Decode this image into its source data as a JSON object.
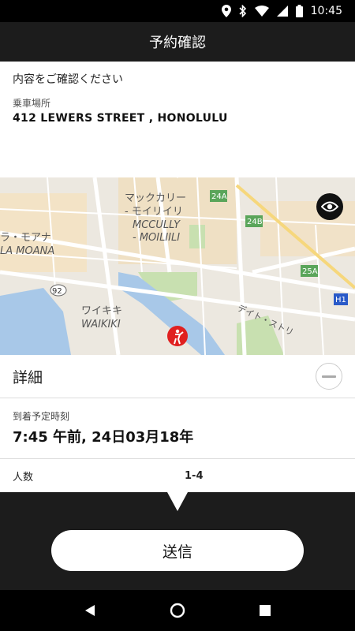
{
  "status_bar": {
    "time": "10:45"
  },
  "app_bar": {
    "title": "予約確認"
  },
  "confirm": {
    "prompt": "内容をご確認ください",
    "pickup_label": "乗車場所",
    "pickup_address": "412 LEWERS STREET , HONOLULU"
  },
  "map": {
    "labels": {
      "mccully_jp": "マックカリー",
      "moiliili_jp": "- モイリイリ",
      "mccully_en": "MCCULLY",
      "moiliili_en": "- MOILIILI",
      "alamoana_jp": "ラ・モアナ",
      "alamoana_en": "LA MOANA",
      "waikiki_jp": "ワイキキ",
      "waikiki_en": "WAIKIKI",
      "road_24a": "24A",
      "road_24b": "24B",
      "road_25a": "25A",
      "road_92": "92",
      "road_h1": "H1",
      "street": "デイト・ストリ"
    }
  },
  "details": {
    "title": "詳細",
    "arrival_label": "到着予定時刻",
    "arrival_value": "7:45 午前, 24日03月18年",
    "people_label": "人数",
    "people_value": "1-4"
  },
  "send_button": {
    "label": "送信"
  },
  "colors": {
    "accent": "#1c1c1c",
    "map_water": "#a8c8e8",
    "map_park": "#c8e0b0",
    "pin": "#e02020"
  }
}
